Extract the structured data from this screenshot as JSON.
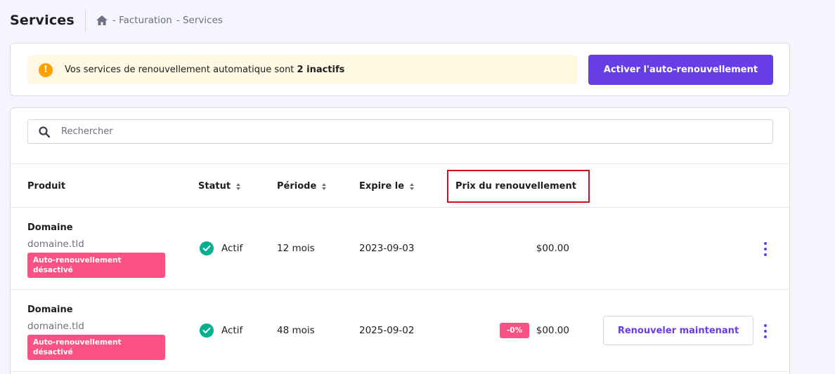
{
  "header": {
    "title": "Services",
    "breadcrumb": [
      "- Facturation",
      "- Services"
    ],
    "home_icon": "home-icon"
  },
  "alert": {
    "icon": "warning-icon",
    "text_prefix": "Vos services de renouvellement automatique sont ",
    "text_bold": "2 inactifs",
    "button_label": "Activer l'auto-renouvellement"
  },
  "search": {
    "placeholder": "Rechercher",
    "value": ""
  },
  "table": {
    "columns": [
      {
        "label": "Produit",
        "sortable": false
      },
      {
        "label": "Statut",
        "sortable": true
      },
      {
        "label": "Période",
        "sortable": true
      },
      {
        "label": "Expire le",
        "sortable": true
      },
      {
        "label": "Prix du renouvellement",
        "sortable": false,
        "highlighted": true
      }
    ],
    "rows": [
      {
        "product": "Domaine",
        "domain": "domaine.tld",
        "badge": "Auto-renouvellement désactivé",
        "status": "Actif",
        "period": "12 mois",
        "expires": "2023-09-03",
        "discount": "",
        "price": "$00.00",
        "action": ""
      },
      {
        "product": "Domaine",
        "domain": "domaine.tld",
        "badge": "Auto-renouvellement désactivé",
        "status": "Actif",
        "period": "48 mois",
        "expires": "2025-09-02",
        "discount": "-0%",
        "price": "$00.00",
        "action": "Renouveler maintenant"
      }
    ]
  },
  "colors": {
    "accent": "#673de6",
    "danger_badge": "#fc5185",
    "success": "#00b090",
    "warning": "#ffa000",
    "highlight_border": "#d00f1a"
  }
}
